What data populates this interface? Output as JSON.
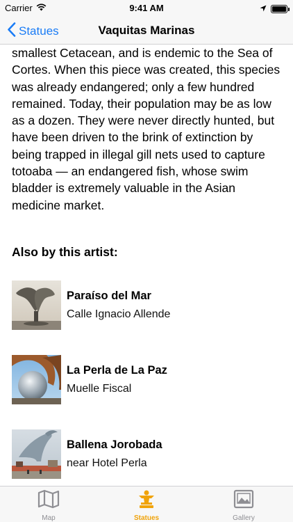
{
  "status": {
    "carrier": "Carrier",
    "time": "9:41 AM"
  },
  "nav": {
    "back_label": "Statues",
    "title": "Vaquitas Marinas"
  },
  "description": "smallest Cetacean, and is endemic to the Sea of Cortes.  When this piece was created, this species was already endangered; only a few hundred remained.  Today, their population may be as low as a dozen.  They were never directly hunted, but have been driven to the brink of extinction by being trapped in illegal gill nets used to capture totoaba — an endangered fish, whose swim bladder is extremely valuable in the Asian medicine market.",
  "also_heading": "Also by this artist:",
  "artworks": [
    {
      "title": "Paraíso del Mar",
      "location": "Calle Ignacio Allende"
    },
    {
      "title": "La Perla de La Paz",
      "location": "Muelle Fiscal"
    },
    {
      "title": "Ballena Jorobada",
      "location": "near Hotel Perla"
    }
  ],
  "tabs": [
    {
      "label": "Map",
      "icon": "map-icon",
      "active": false
    },
    {
      "label": "Statues",
      "icon": "statue-icon",
      "active": true
    },
    {
      "label": "Gallery",
      "icon": "gallery-icon",
      "active": false
    }
  ],
  "colors": {
    "accent_blue": "#1a7cf6",
    "active_tab": "#f0a30a",
    "inactive_tab": "#8e8e93"
  }
}
